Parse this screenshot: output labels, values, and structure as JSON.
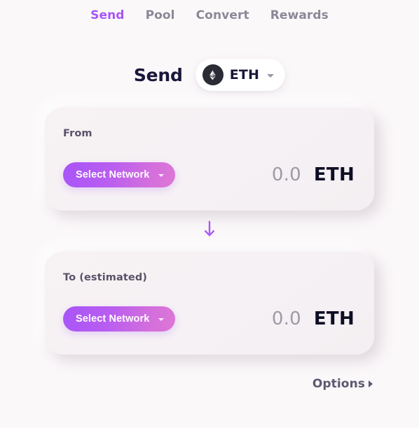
{
  "nav": {
    "tabs": [
      {
        "label": "Send",
        "active": true
      },
      {
        "label": "Pool",
        "active": false
      },
      {
        "label": "Convert",
        "active": false
      },
      {
        "label": "Rewards",
        "active": false
      }
    ]
  },
  "header": {
    "title": "Send",
    "token": {
      "symbol": "ETH",
      "icon": "ethereum-icon",
      "caret": "chevron-down-icon"
    }
  },
  "from_card": {
    "label": "From",
    "network_button": {
      "label": "Select Network",
      "caret": "chevron-down-icon"
    },
    "amount": "0.0",
    "unit": "ETH"
  },
  "direction": {
    "icon": "arrow-down-icon"
  },
  "to_card": {
    "label": "To (estimated)",
    "network_button": {
      "label": "Select Network",
      "caret": "chevron-down-icon"
    },
    "amount": "0.0",
    "unit": "ETH"
  },
  "footer": {
    "options_label": "Options",
    "options_caret": "caret-right-icon"
  },
  "colors": {
    "accent_purple": "#a855f7",
    "accent_pink": "#dd77d6",
    "background": "#fbf8fa",
    "card": "#f5f1f4",
    "text_dark": "#191739",
    "text_muted": "#8c8796",
    "amount_placeholder": "#9e9aa6"
  }
}
